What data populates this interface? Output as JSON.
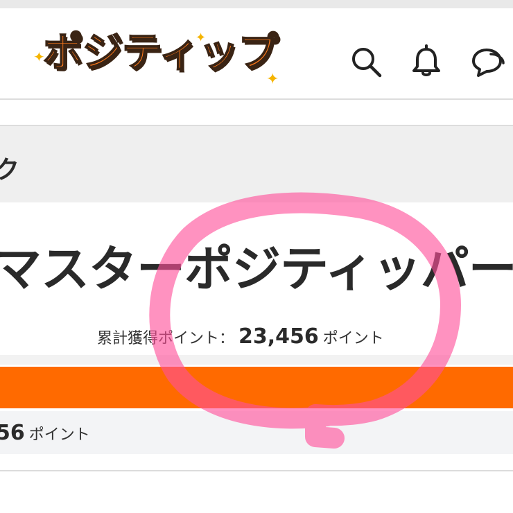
{
  "header": {
    "logo_text": "ポジティップ",
    "icons": [
      "search-icon",
      "bell-icon",
      "chat-icon"
    ]
  },
  "section": {
    "label_fragment": "ク"
  },
  "rank": {
    "title": "マスターポジティッパー"
  },
  "points": {
    "label": "累計獲得ポイント：",
    "value": "23,456",
    "unit": "ポイント"
  },
  "progress": {
    "value_fragment": "56",
    "unit": "ポイント",
    "bar_color": "#ff6a00"
  },
  "colors": {
    "brand": "#ff7a1a",
    "annotation": "#ff4f9a"
  }
}
